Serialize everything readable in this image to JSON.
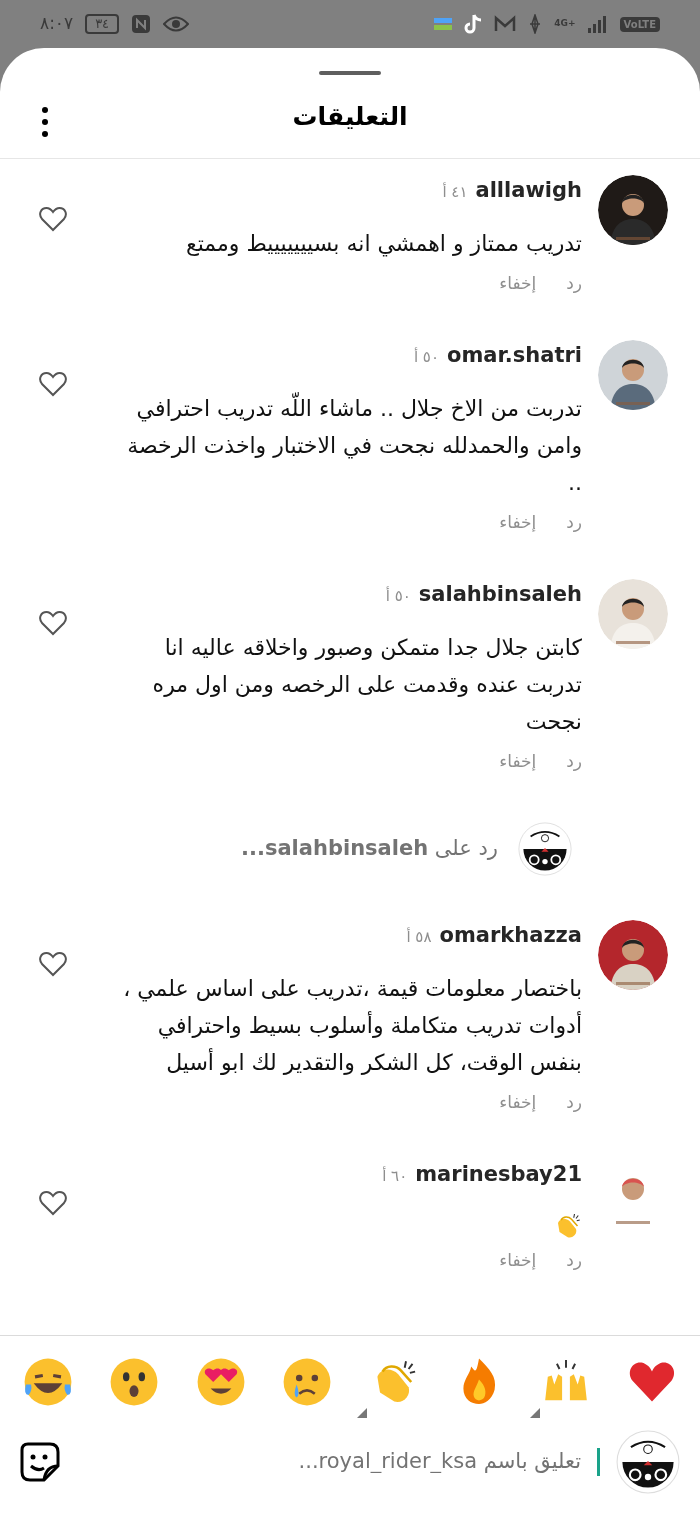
{
  "status_bar": {
    "time": "٨:٠٧",
    "battery": "٣٤",
    "network": "4G+",
    "volte": "VoLTE"
  },
  "sheet": {
    "title": "التعليقات"
  },
  "comments": [
    {
      "username": "alllawigh",
      "time": "٤١ أ",
      "kind": "text",
      "body": "تدريب ممتاز و اهمشي انه بسيييييييط وممتع",
      "reply": "رد",
      "hide": "إخفاء",
      "liked": false
    },
    {
      "username": "omar.shatri",
      "time": "٥٠ أ",
      "kind": "text",
      "body": "تدربت من الاخ جلال .. ماشاء اللّه تدريب احترافي وامن والحمدلله نجحت في الاختبار واخذت الرخصة ..",
      "reply": "رد",
      "hide": "إخفاء",
      "liked": false
    },
    {
      "username": "salahbinsaleh",
      "time": "٥٠ أ",
      "kind": "text",
      "body": "كابتن جلال جدا متمكن وصبور واخلاقه عاليه انا تدربت عنده وقدمت على الرخصه ومن اول مره نجحت",
      "reply": "رد",
      "hide": "إخفاء",
      "liked": false,
      "view_replies": "رد على **salahbinsaleh...**"
    },
    {
      "username": "omarkhazza",
      "time": "٥٨ أ",
      "kind": "text",
      "body": "باختصار معلومات قيمة ،تدريب على اساس علمي ، أدوات تدريب متكاملة وأسلوب بسيط واحترافي بنفس الوقت، كل الشكر والتقدير لك ابو أسيل",
      "reply": "رد",
      "hide": "إخفاء",
      "liked": false
    },
    {
      "username": "marinesbay21",
      "time": "٦٠ أ",
      "kind": "emoji",
      "reply": "رد",
      "hide": "إخفاء",
      "liked": false
    }
  ],
  "reactions": [
    {
      "kind": "heart",
      "variants": false
    },
    {
      "kind": "raised-hands",
      "variants": true
    },
    {
      "kind": "fire",
      "variants": false
    },
    {
      "kind": "clap",
      "variants": true
    },
    {
      "kind": "crying",
      "variants": false
    },
    {
      "kind": "heart-eyes",
      "variants": false
    },
    {
      "kind": "surprised",
      "variants": false
    },
    {
      "kind": "laughing",
      "variants": false
    }
  ],
  "composer": {
    "placeholder": "تعليق باسم royal_rider_ksa..."
  }
}
